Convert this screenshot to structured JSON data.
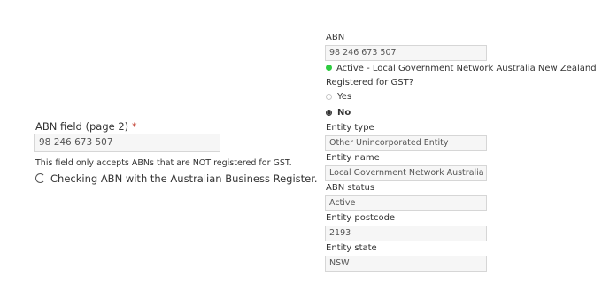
{
  "left": {
    "field_label": "ABN field (page 2)",
    "required_marker": "*",
    "abn_value": "98 246 673 507",
    "help_text": "This field only accepts ABNs that are NOT registered for GST.",
    "checking_text": "Checking ABN with the Australian Business Register."
  },
  "right": {
    "abn_label": "ABN",
    "abn_value": "98 246 673 507",
    "status_line": "Active - Local Government Network Australia New Zealand",
    "status_color": "#2ecc40",
    "gst_label": "Registered for GST?",
    "gst_options": [
      "Yes",
      "No"
    ],
    "gst_selected": "No",
    "entity_type_label": "Entity type",
    "entity_type_value": "Other Unincorporated Entity",
    "entity_name_label": "Entity name",
    "entity_name_value": "Local Government Network Australia New Zealand",
    "abn_status_label": "ABN status",
    "abn_status_value": "Active",
    "postcode_label": "Entity postcode",
    "postcode_value": "2193",
    "state_label": "Entity state",
    "state_value": "NSW"
  }
}
